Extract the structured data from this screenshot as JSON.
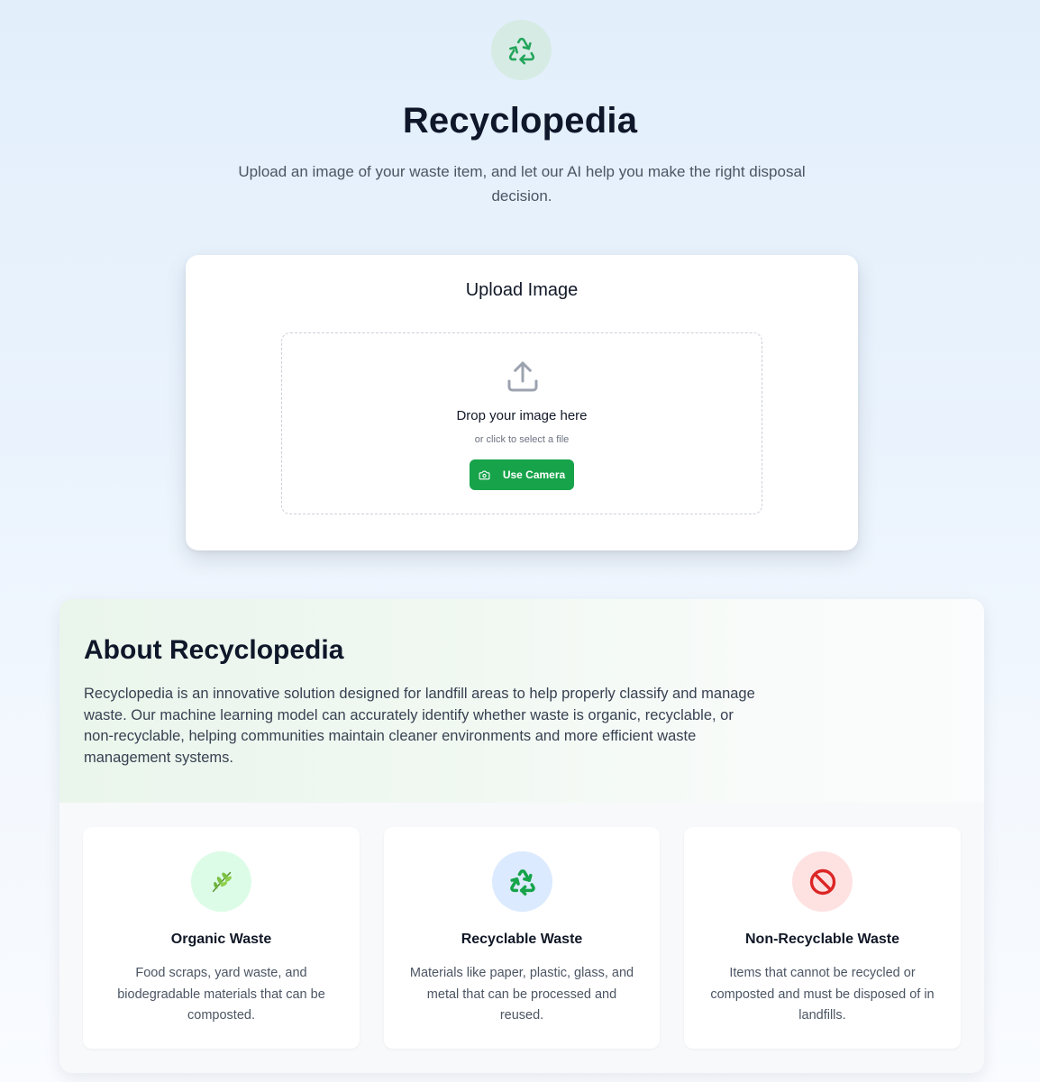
{
  "header": {
    "logo_icon": "recycle-icon",
    "title": "Recyclopedia",
    "subtitle": "Upload an image of your waste item, and let our AI help you make the right disposal decision."
  },
  "upload": {
    "title": "Upload Image",
    "dropzone_title": "Drop your image here",
    "dropzone_subtitle": "or click to select a file",
    "upload_icon": "upload-icon",
    "camera_button_label": "Use Camera",
    "camera_icon": "camera-icon"
  },
  "about": {
    "title": "About Recyclopedia",
    "description": "Recyclopedia is an innovative solution designed for landfill areas to help properly classify and manage waste. Our machine learning model can accurately identify whether waste is organic, recyclable, or non-recyclable, helping communities maintain cleaner environments and more efficient waste management systems.",
    "categories": [
      {
        "title": "Organic Waste",
        "description": "Food scraps, yard waste, and biodegradable materials that can be composted.",
        "icon": "herb-icon"
      },
      {
        "title": "Recyclable Waste",
        "description": "Materials like paper, plastic, glass, and metal that can be processed and reused.",
        "icon": "recycle-icon"
      },
      {
        "title": "Non-Recyclable Waste",
        "description": "Items that cannot be recycled or composted and must be disposed of in landfills.",
        "icon": "prohibited-icon"
      }
    ]
  },
  "colors": {
    "accent_green": "#16a34a",
    "organic_bg": "#dcfce7",
    "recyclable_bg": "#dbeafe",
    "non_recyclable_bg": "#fee2e2"
  }
}
